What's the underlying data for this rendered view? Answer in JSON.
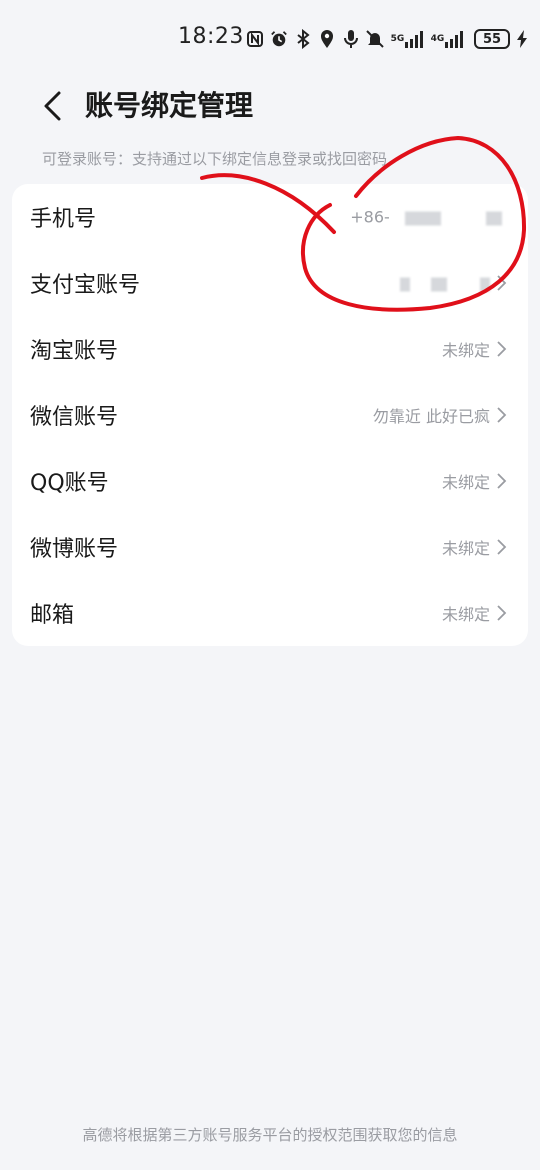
{
  "status_bar": {
    "time": "18:23",
    "sim1_label": "5G",
    "sim2_label": "4G",
    "battery": "55"
  },
  "header": {
    "title": "账号绑定管理"
  },
  "hint": "可登录账号：支持通过以下绑定信息登录或找回密码",
  "rows": [
    {
      "label": "手机号",
      "value": "+86-"
    },
    {
      "label": "支付宝账号",
      "value": ""
    },
    {
      "label": "淘宝账号",
      "value": "未绑定"
    },
    {
      "label": "微信账号",
      "value": "勿靠近 此好已疯"
    },
    {
      "label": "QQ账号",
      "value": "未绑定"
    },
    {
      "label": "微博账号",
      "value": "未绑定"
    },
    {
      "label": "邮箱",
      "value": "未绑定"
    }
  ],
  "footer": "高德将根据第三方账号服务平台的授权范围获取您的信息",
  "colors": {
    "background": "#f4f5f8",
    "card": "#ffffff",
    "secondary_text": "#9a9ca2",
    "annotation": "#e0101a"
  }
}
